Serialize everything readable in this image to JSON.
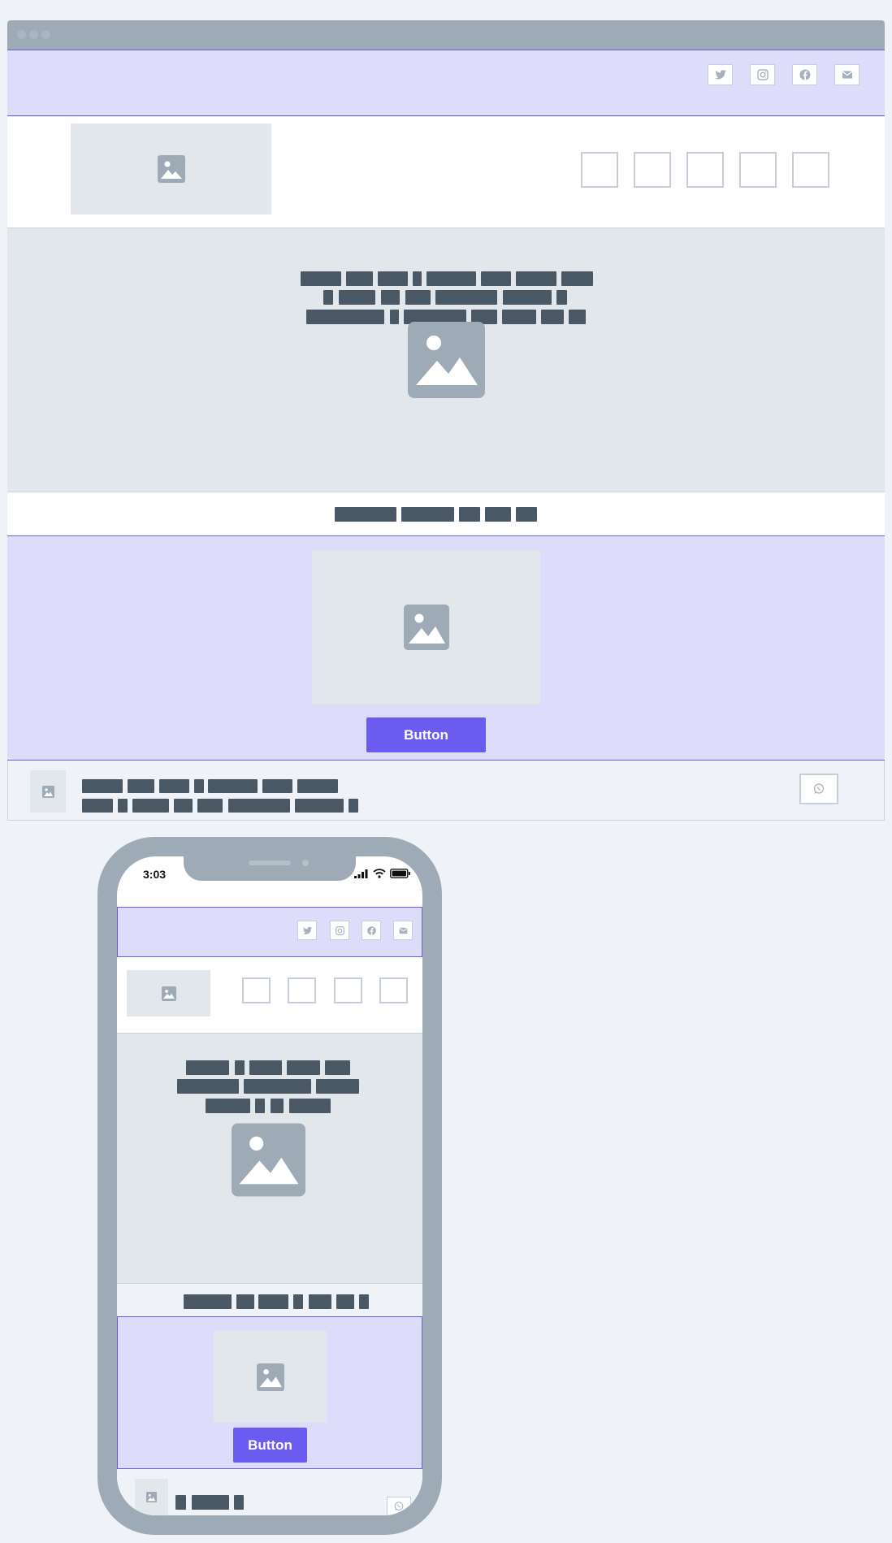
{
  "desktop": {
    "social_icons": [
      "twitter-icon",
      "instagram-icon",
      "facebook-icon",
      "mail-icon"
    ],
    "nav_items": [
      "",
      "",
      "",
      "",
      ""
    ],
    "hero": {
      "image_icon": "image-icon"
    },
    "cta": {
      "button_label": "Button",
      "image_icon": "image-icon"
    },
    "footer": {
      "contact_icon": "whatsapp-icon"
    }
  },
  "mobile": {
    "status": {
      "time": "3:03"
    },
    "social_icons": [
      "twitter-icon",
      "instagram-icon",
      "facebook-icon",
      "mail-icon"
    ],
    "cta": {
      "button_label": "Button"
    },
    "footer": {
      "contact_icon": "whatsapp-icon"
    }
  },
  "colors": {
    "page_bg": "#eff2f6",
    "frame": "#9eabb7",
    "accent": "#6b5cf0",
    "tint": "#ddddfb",
    "placeholder": "#e2e7ec",
    "text_bar": "#4a5865"
  }
}
